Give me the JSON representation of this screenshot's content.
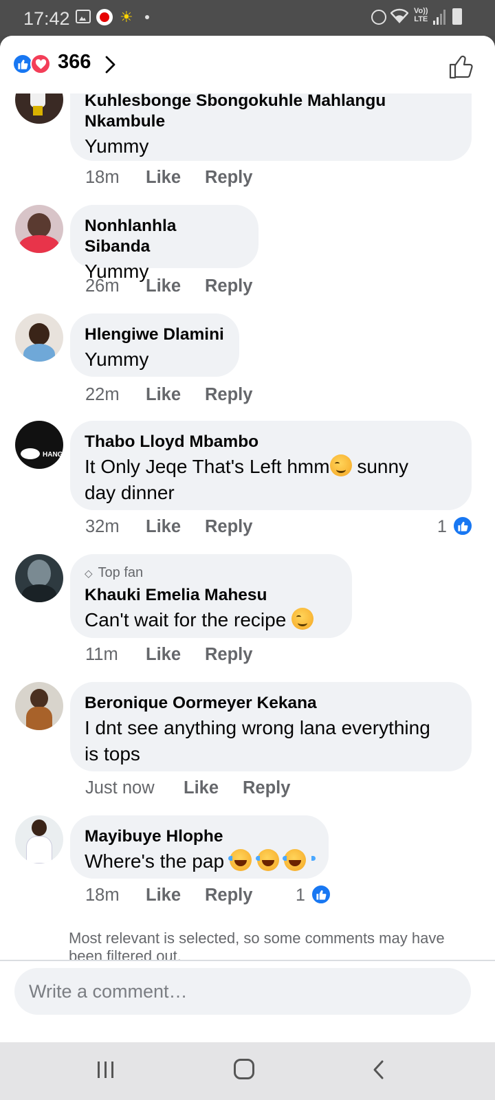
{
  "status_bar": {
    "time": "17:42",
    "icons": [
      "gallery-icon",
      "vodafone-icon",
      "sun-icon",
      "dot-icon",
      "alarm-icon",
      "wifi-icon",
      "volte-icon",
      "signal-icon",
      "battery-icon"
    ],
    "volte_top": "Vo))",
    "volte_bottom": "LTE"
  },
  "header": {
    "reaction_count": "366",
    "reaction_icons": [
      "like-reaction-icon",
      "love-reaction-icon"
    ]
  },
  "comments": [
    {
      "author_line1": "Kuhlesbonge Sbongokuhle Mahlangu",
      "author_line2": "Nkambule",
      "text": "Yummy",
      "time": "18m",
      "like": "Like",
      "reply": "Reply"
    },
    {
      "author": "Nonhlanhla Sibanda",
      "text": "Yummy",
      "time": "26m",
      "like": "Like",
      "reply": "Reply"
    },
    {
      "author": "Hlengiwe Dlamini",
      "text": "Yummy",
      "time": "22m",
      "like": "Like",
      "reply": "Reply"
    },
    {
      "author": "Thabo Lloyd Mbambo",
      "text_part1": "It Only Jeqe That's Left hmm",
      "text_part2": " sunny",
      "text_line2": "day dinner",
      "time": "32m",
      "like": "Like",
      "reply": "Reply",
      "reaction_count": "1"
    },
    {
      "badge": "Top fan",
      "author": "Khauki Emelia Mahesu",
      "text": "Can't  wait for the recipe ",
      "time": "11m",
      "like": "Like",
      "reply": "Reply"
    },
    {
      "author": "Beronique Oormeyer Kekana",
      "text_line1": "I dnt see anything wrong lana everything",
      "text_line2": "is tops",
      "time": "Just now",
      "like": "Like",
      "reply": "Reply"
    },
    {
      "author": "Mayibuye Hlophe",
      "text": "Where's the pap ",
      "time": "18m",
      "like": "Like",
      "reply": "Reply",
      "reaction_count": "1"
    }
  ],
  "filter_note": "Most relevant is selected, so some comments may have been filtered out.",
  "composer": {
    "placeholder": "Write a comment…"
  },
  "colors": {
    "facebook_blue": "#1877f2",
    "love_red": "#f33e58",
    "bubble_bg": "#f0f2f5",
    "secondary_text": "#65676b"
  }
}
